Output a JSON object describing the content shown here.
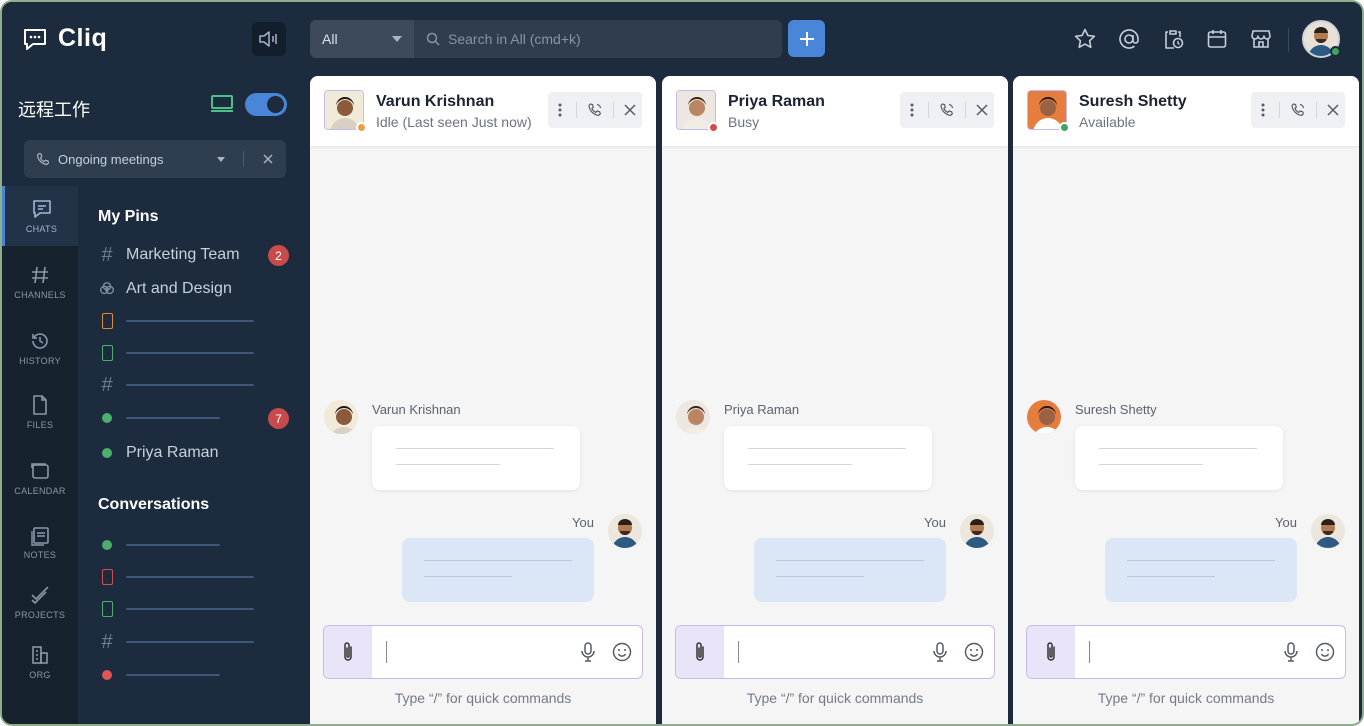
{
  "app": {
    "name": "Cliq"
  },
  "search": {
    "scope": "All",
    "placeholder": "Search in All (cmd+k)"
  },
  "workspace": {
    "title": "远程工作"
  },
  "meetings": {
    "label": "Ongoing meetings"
  },
  "rail": [
    {
      "label": "CHATS",
      "icon": "chat-icon",
      "active": true
    },
    {
      "label": "CHANNELS",
      "icon": "hash-icon"
    },
    {
      "label": "HISTORY",
      "icon": "history-icon"
    },
    {
      "label": "FILES",
      "icon": "file-icon"
    },
    {
      "label": "CALENDAR",
      "icon": "calendar-icon"
    },
    {
      "label": "NOTES",
      "icon": "notes-icon"
    },
    {
      "label": "PROJECTS",
      "icon": "projects-icon"
    },
    {
      "label": "ORG",
      "icon": "org-icon"
    }
  ],
  "pins": {
    "heading": "My Pins",
    "items": [
      {
        "label": "Marketing Team",
        "icon": "hash-icon",
        "badge": "2"
      },
      {
        "label": "Art and Design",
        "icon": "group-icon"
      },
      {
        "label": "",
        "icon": "phone-icon",
        "color": "#d98b3e"
      },
      {
        "label": "",
        "icon": "phone-icon",
        "color": "#4caf6e"
      },
      {
        "label": "",
        "icon": "hash-icon"
      },
      {
        "label": "",
        "icon": "status-dot",
        "color": "#4caf6e",
        "badge": "7"
      },
      {
        "label": "Priya Raman",
        "icon": "status-dot",
        "color": "#4caf6e"
      }
    ]
  },
  "conversations": {
    "heading": "Conversations",
    "items": [
      {
        "icon": "status-dot",
        "color": "#4caf6e"
      },
      {
        "icon": "phone-icon",
        "color": "#d05050"
      },
      {
        "icon": "phone-icon",
        "color": "#4caf6e"
      },
      {
        "icon": "hash-icon"
      },
      {
        "icon": "status-dot",
        "color": "#e05555"
      }
    ]
  },
  "chats": [
    {
      "name": "Varun Krishnan",
      "status": "Idle (Last seen Just now)",
      "status_color": "#e5a04c",
      "sender": "Varun Krishnan",
      "you_label": "You",
      "hint": "Type “/” for quick commands"
    },
    {
      "name": "Priya Raman",
      "status": "Busy",
      "status_color": "#d24a4a",
      "sender": "Priya Raman",
      "you_label": "You",
      "hint": "Type “/” for quick commands"
    },
    {
      "name": "Suresh Shetty",
      "status": "Available",
      "status_color": "#3ea45f",
      "sender": "Suresh Shetty",
      "you_label": "You",
      "hint": "Type “/” for quick commands"
    }
  ],
  "colors": {
    "accent": "#4a86d8",
    "sidebar": "#1c2b3d",
    "rail": "#17222f"
  }
}
